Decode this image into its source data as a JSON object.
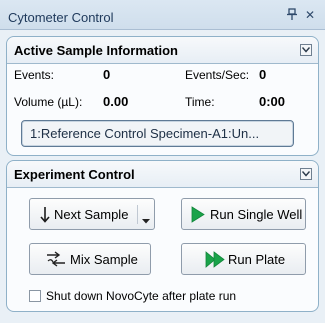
{
  "window": {
    "title": "Cytometer Control",
    "pin_glyph": "ઐ",
    "close_glyph": "✕"
  },
  "active_sample": {
    "header": "Active Sample Information",
    "events_label": "Events:",
    "events_value": "0",
    "events_sec_label": "Events/Sec:",
    "events_sec_value": "0",
    "volume_label": "Volume (µL):",
    "volume_value": "0.00",
    "time_label": "Time:",
    "time_value": "0:00",
    "sample_name": "1:Reference Control Specimen-A1:Un..."
  },
  "experiment": {
    "header": "Experiment Control",
    "next_sample": "Next Sample",
    "run_single_well": "Run Single Well",
    "mix_sample": "Mix Sample",
    "run_plate": "Run Plate",
    "shutdown_label": "Shut down NovoCyte after plate run",
    "shutdown_checked": false
  },
  "colors": {
    "run_green": "#1aa34a",
    "header_text": "#1e395b"
  }
}
